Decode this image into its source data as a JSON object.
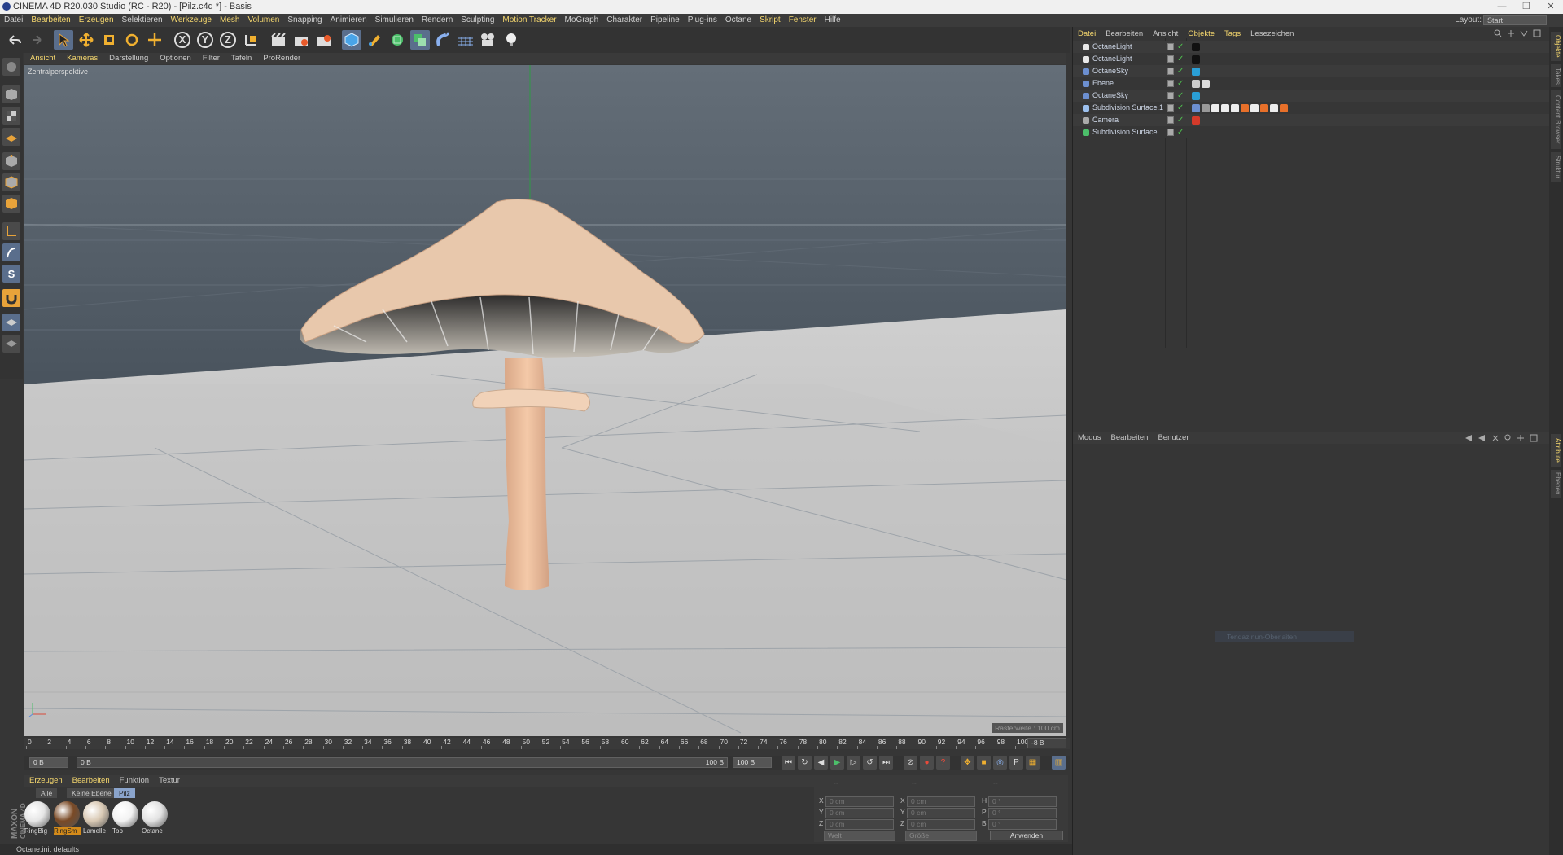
{
  "window": {
    "title": "CINEMA 4D R20.030 Studio (RC - R20) - [Pilz.c4d *] - Basis",
    "controls": [
      "—",
      "❐",
      "✕"
    ]
  },
  "menubar": {
    "items": [
      "Datei",
      "Bearbeiten",
      "Erzeugen",
      "Selektieren",
      "Werkzeuge",
      "Mesh",
      "Volumen",
      "Snapping",
      "Animieren",
      "Simulieren",
      "Rendern",
      "Sculpting",
      "Motion Tracker",
      "MoGraph",
      "Charakter",
      "Pipeline",
      "Plug-ins",
      "Octane",
      "Skript",
      "Fenster",
      "Hilfe"
    ],
    "layout_label": "Layout:",
    "layout_value": "Start"
  },
  "toolbar": {
    "axis_x": "X",
    "axis_y": "Y",
    "axis_z": "Z"
  },
  "lefttools": {
    "snap_label": "S"
  },
  "viewport": {
    "menu": [
      "Ansicht",
      "Kameras",
      "Darstellung",
      "Optionen",
      "Filter",
      "Tafeln",
      "ProRender"
    ],
    "label": "Zentralperspektive",
    "raster": "Rasterweite : 100 cm"
  },
  "timeline": {
    "ticks": [
      "0",
      "2",
      "4",
      "6",
      "8",
      "10",
      "12",
      "14",
      "16",
      "18",
      "20",
      "22",
      "24",
      "26",
      "28",
      "30",
      "32",
      "34",
      "36",
      "38",
      "40",
      "42",
      "44",
      "46",
      "48",
      "50",
      "52",
      "54",
      "56",
      "58",
      "60",
      "62",
      "64",
      "66",
      "68",
      "70",
      "72",
      "74",
      "76",
      "78",
      "80",
      "82",
      "84",
      "86",
      "88",
      "90",
      "92",
      "94",
      "96",
      "98",
      "100"
    ],
    "frame_field": "-8 B"
  },
  "playbar": {
    "start": "0 B",
    "current": "0 B",
    "end_label": "100 B",
    "end": "100 B"
  },
  "materials": {
    "menu": [
      "Erzeugen",
      "Bearbeiten",
      "Funktion",
      "Textur"
    ],
    "filters": [
      "Alle",
      "Keine Ebene",
      "Pilz"
    ],
    "items": [
      {
        "name": "RingBig",
        "color": "#e6e6e6"
      },
      {
        "name": "RingSm",
        "color": "#7a4a26",
        "selected": true
      },
      {
        "name": "Lamelle",
        "color": "#d9c9b4"
      },
      {
        "name": "Top",
        "color": "#f2f2f2"
      },
      {
        "name": "Octane",
        "color": "#e2e2e2"
      }
    ]
  },
  "coords": {
    "top1": "--",
    "top2": "--",
    "top3": "--",
    "rows": [
      {
        "a": "X",
        "av": "0 cm",
        "b": "X",
        "bv": "0 cm",
        "c": "H",
        "cv": "0 °"
      },
      {
        "a": "Y",
        "av": "0 cm",
        "b": "Y",
        "bv": "0 cm",
        "c": "P",
        "cv": "0 °"
      },
      {
        "a": "Z",
        "av": "0 cm",
        "b": "Z",
        "bv": "0 cm",
        "c": "B",
        "cv": "0 °"
      }
    ],
    "mode1": "Welt",
    "mode2": "Größe",
    "apply": "Anwenden"
  },
  "status": "Octane:init defaults",
  "brand": {
    "line1": "MAXON",
    "line2": "CINEMA 4D"
  },
  "objects": {
    "menu": [
      "Datei",
      "Bearbeiten",
      "Ansicht",
      "Objekte",
      "Tags",
      "Lesezeichen"
    ],
    "rows": [
      {
        "name": "OctaneLight",
        "icon": "#e8e8e8",
        "tags": [
          "#111"
        ]
      },
      {
        "name": "OctaneLight",
        "icon": "#e8e8e8",
        "tags": [
          "#111"
        ]
      },
      {
        "name": "OctaneSky",
        "icon": "#6c8fd0",
        "tags": [
          "#2a9fd6"
        ]
      },
      {
        "name": "Ebene",
        "icon": "#6c8fd0",
        "tags": [
          "#ccc",
          "#ddd"
        ]
      },
      {
        "name": "OctaneSky",
        "icon": "#6c8fd0",
        "tags": [
          "#2a9fd6"
        ]
      },
      {
        "name": "Subdivision Surface.1",
        "icon": "#9cc0ee",
        "tags": [
          "#6c8fd0",
          "#999",
          "#eee",
          "#eee",
          "#eee",
          "#e8702a",
          "#eee",
          "#e8702a",
          "#eee",
          "#e8702a"
        ]
      },
      {
        "name": "Camera",
        "icon": "#aaa",
        "tags": [
          "#d43a2a"
        ]
      },
      {
        "name": "Subdivision Surface",
        "icon": "#4cbf6a",
        "tags": []
      }
    ]
  },
  "attributes": {
    "menu": [
      "Modus",
      "Bearbeiten",
      "Benutzer"
    ],
    "hint": "Tendaz nun-Oberiaiten"
  },
  "sidetabs": [
    "Objekte",
    "Takes",
    "Content Browser",
    "Struktur",
    "Attribute",
    "Ebenen"
  ]
}
